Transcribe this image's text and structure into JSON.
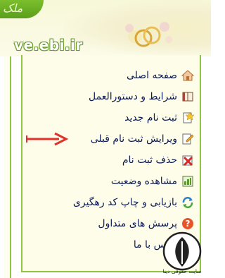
{
  "header": {
    "tab_text": "ملک",
    "site_title": "ve.ebi.ir"
  },
  "menu": [
    {
      "label": "صفحه اصلی",
      "icon": "home-icon"
    },
    {
      "label": "شرايط و دستورالعمل",
      "icon": "book-icon"
    },
    {
      "label": "ثبت نام جديد",
      "icon": "new-form-icon"
    },
    {
      "label": "ويرايش ثبت نام قبلی",
      "icon": "edit-pencil-icon"
    },
    {
      "label": "حذف ثبت نام",
      "icon": "delete-x-icon"
    },
    {
      "label": "مشاهده وضعيت",
      "icon": "status-view-icon"
    },
    {
      "label": "بازيابی و چاپ کد رهگيری",
      "icon": "refresh-icon"
    },
    {
      "label": "پرسش های متداول",
      "icon": "help-icon"
    },
    {
      "label": "تماس با ما",
      "icon": "contact-document-icon"
    }
  ],
  "annotation": {
    "arrow_target": "ويرايش ثبت نام قبلی",
    "arrow_color": "#e0312b"
  },
  "watermark": {
    "text": "سایت حقوقی دینا"
  },
  "colors": {
    "accent_green": "#8ec63f",
    "menu_text": "#0e1c55",
    "panel_bg": "#fefde9"
  }
}
